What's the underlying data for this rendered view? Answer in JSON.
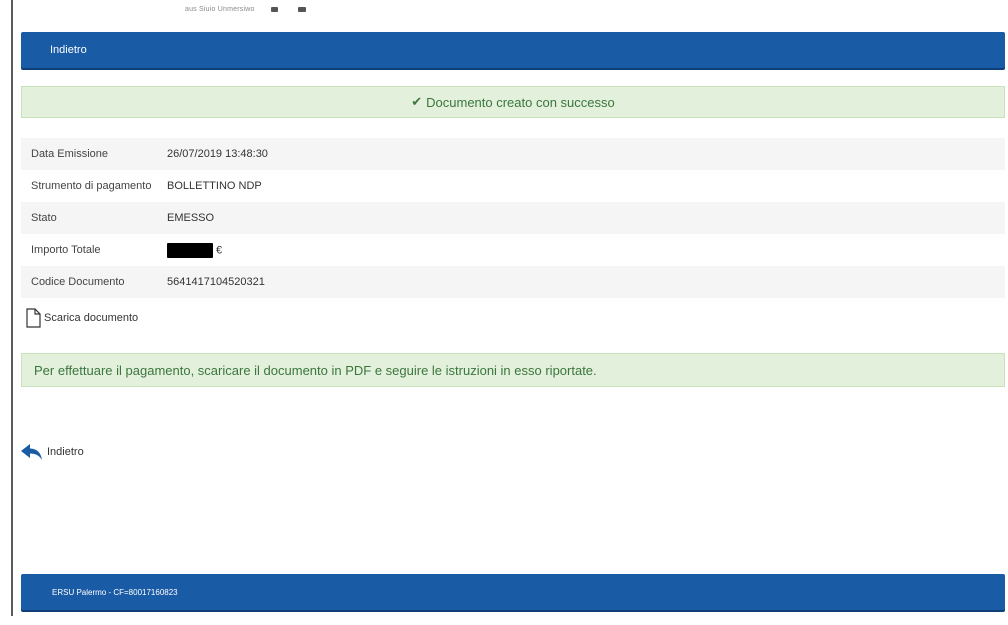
{
  "top_fragment": {
    "text": "aus Siuio Unmersiwo"
  },
  "header": {
    "back_label": "Indietro"
  },
  "alert_success": {
    "message": "Documento creato con successo",
    "icon": "check-icon"
  },
  "details": {
    "rows": [
      {
        "label": "Data Emissione",
        "value": "26/07/2019 13:48:30"
      },
      {
        "label": "Strumento di pagamento",
        "value": "BOLLETTINO NDP"
      },
      {
        "label": "Stato",
        "value": "EMESSO"
      },
      {
        "label": "Importo Totale",
        "value": "€"
      },
      {
        "label": "Codice Documento",
        "value": "5641417104520321"
      }
    ]
  },
  "download": {
    "label": "Scarica documento",
    "icon": "document-icon"
  },
  "info": {
    "message": "Per effettuare il pagamento, scaricare il documento in PDF e seguire le istruzioni in esso riportate."
  },
  "back_link": {
    "label": "Indietro",
    "icon": "reply-arrow-icon"
  },
  "footer": {
    "text": "ERSU Palermo - CF=80017160823"
  },
  "colors": {
    "primary": "#1a5ba6",
    "success_bg": "#e2f0dc",
    "success_text": "#3c763d"
  }
}
